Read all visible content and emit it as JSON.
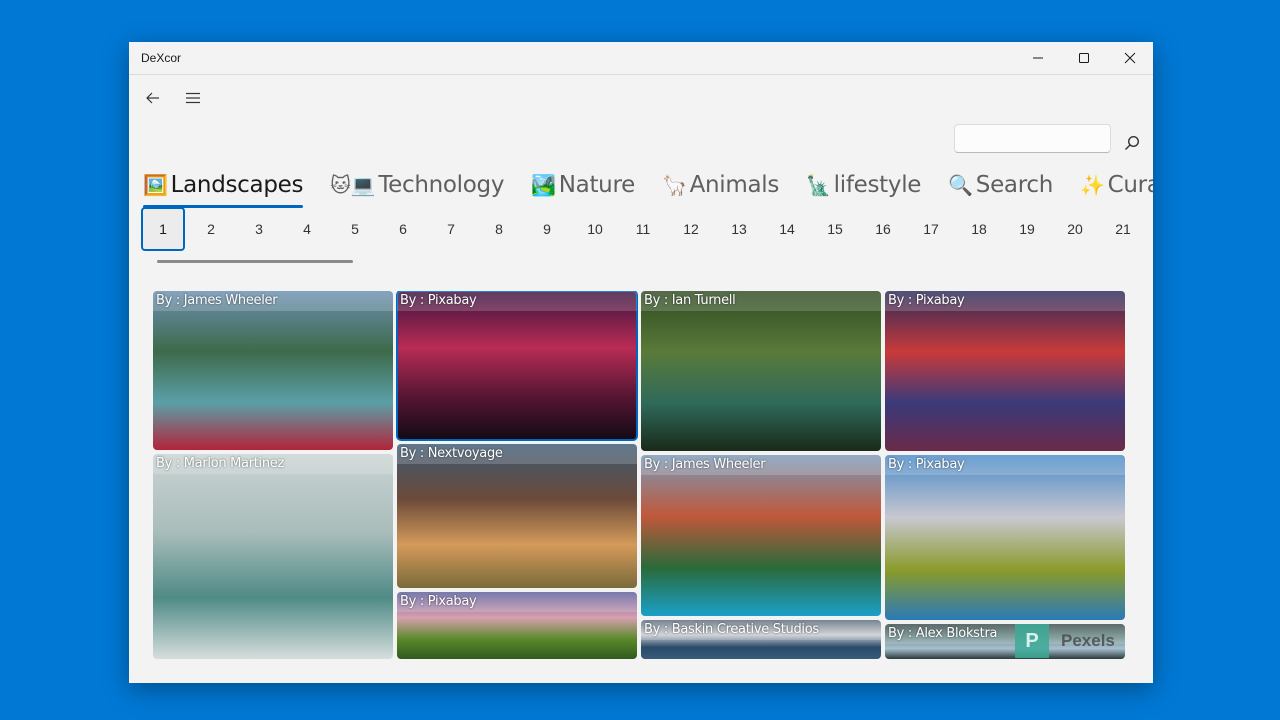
{
  "window": {
    "title": "DeXcor",
    "controls": {
      "minimize": "minimize-icon",
      "maximize": "maximize-icon",
      "close": "close-icon"
    }
  },
  "nav": {
    "back_icon": "back-arrow-icon",
    "menu_icon": "hamburger-menu-icon"
  },
  "search": {
    "value": "",
    "placeholder": "",
    "button_icon": "search-icon"
  },
  "tabs": [
    {
      "emoji": "🖼️",
      "label": "Landscapes",
      "active": true
    },
    {
      "emoji": "🐱💻",
      "label": "Technology",
      "active": false
    },
    {
      "emoji": "🏞️",
      "label": "Nature",
      "active": false
    },
    {
      "emoji": "🦙",
      "label": "Animals",
      "active": false
    },
    {
      "emoji": "🗽",
      "label": "lifestyle",
      "active": false
    },
    {
      "emoji": "🔍",
      "label": "Search",
      "active": false
    },
    {
      "emoji": "✨",
      "label": "Curate",
      "active": false
    }
  ],
  "pager": {
    "selected": "1",
    "pages": [
      "1",
      "2",
      "3",
      "4",
      "5",
      "6",
      "7",
      "8",
      "9",
      "10",
      "11",
      "12",
      "13",
      "14",
      "15",
      "16",
      "17",
      "18",
      "19",
      "20",
      "21"
    ]
  },
  "photos": [
    {
      "credit": "By : James Wheeler",
      "colors": [
        "#6b8fb0",
        "#3e6a4a",
        "#5aa0a8",
        "#b2243a"
      ]
    },
    {
      "credit": "By : Marlon Martinez",
      "colors": [
        "#c9d3d2",
        "#a9bdbb",
        "#4f8a86",
        "#d6dedd"
      ]
    },
    {
      "credit": "By : Pixabay",
      "colors": [
        "#3a1240",
        "#b82c55",
        "#581634",
        "#120a14"
      ],
      "selected": true
    },
    {
      "credit": "By : Nextvoyage",
      "colors": [
        "#3e5a73",
        "#6b4a3a",
        "#d49a5a",
        "#7a6a3a"
      ]
    },
    {
      "credit": "By : Pixabay",
      "colors": [
        "#5a5c9a",
        "#d8a0b0",
        "#5a8a2a",
        "#2f5a1f"
      ]
    },
    {
      "credit": "By : Ian Turnell",
      "colors": [
        "#2f4a22",
        "#5a7a3a",
        "#2f6a5a",
        "#1a2a1a"
      ]
    },
    {
      "credit": "By : James Wheeler",
      "colors": [
        "#7a9ab8",
        "#c0583a",
        "#2a6a3a",
        "#1aa0c8"
      ]
    },
    {
      "credit": "By : Baskin Creative Studios",
      "colors": [
        "#586a7a",
        "#c8ccd0",
        "#2a4a6a",
        "#3a5a7a"
      ]
    },
    {
      "credit": "By : Pixabay",
      "colors": [
        "#2a2a5a",
        "#c83a3a",
        "#3a3a7a",
        "#6a2a4a"
      ]
    },
    {
      "credit": "By : Pixabay",
      "colors": [
        "#4a8ac8",
        "#c8c8d0",
        "#8a9a2a",
        "#2a7ab8"
      ]
    },
    {
      "credit": "By : Alex Blokstra",
      "colors": [
        "#3a4a4a",
        "#6a8a8a",
        "#a8c0d0",
        "#2a3a3a"
      ]
    }
  ],
  "watermark": {
    "logo": "P",
    "text": "Pexels"
  }
}
